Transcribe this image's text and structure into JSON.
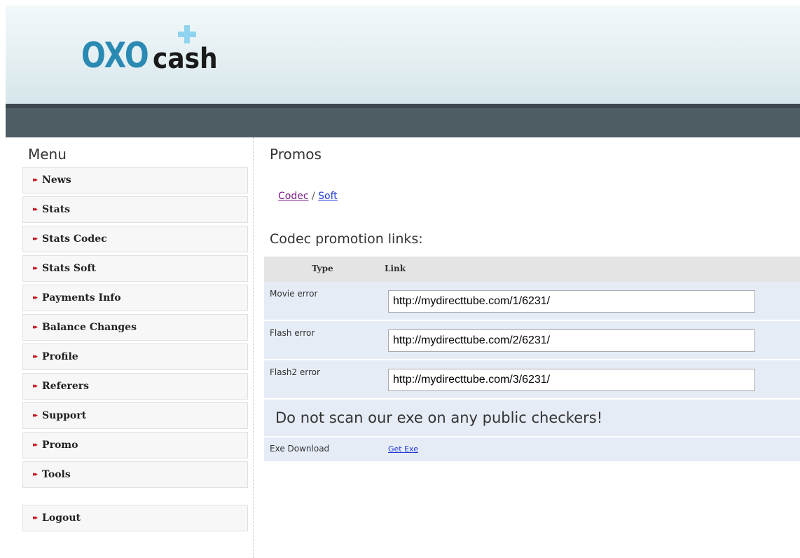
{
  "logo": {
    "oxo": "OXO",
    "cash": "cash"
  },
  "colors": {
    "accent": "#2a8ab3",
    "arrow": "#c0141c",
    "bar": "#4e5c63",
    "row_bg": "#e6ecf6",
    "link": "#1f3bd6",
    "visited": "#7a1d8a"
  },
  "sidebar": {
    "title": "Menu",
    "arrow": "▸▸",
    "items": [
      {
        "label": "News"
      },
      {
        "label": "Stats"
      },
      {
        "label": "Stats Codec"
      },
      {
        "label": "Stats Soft"
      },
      {
        "label": "Payments Info"
      },
      {
        "label": "Balance Changes"
      },
      {
        "label": "Profile"
      },
      {
        "label": "Referers"
      },
      {
        "label": "Support"
      },
      {
        "label": "Promo"
      },
      {
        "label": "Tools"
      }
    ],
    "logout": {
      "label": "Logout"
    }
  },
  "main": {
    "title": "Promos",
    "crumbs": {
      "codec": "Codec",
      "sep": " / ",
      "soft": "Soft"
    },
    "section_title": "Codec promotion links:",
    "table": {
      "headers": {
        "type": "Type",
        "link": "Link"
      },
      "rows": [
        {
          "type": "Movie error",
          "link": "http://mydirecttube.com/1/6231/"
        },
        {
          "type": "Flash error",
          "link": "http://mydirecttube.com/2/6231/"
        },
        {
          "type": "Flash2 error",
          "link": "http://mydirecttube.com/3/6231/"
        }
      ],
      "warning": "Do not scan our exe on any public checkers!",
      "download": {
        "type": "Exe Download",
        "link_label": "Get Exe"
      }
    }
  }
}
